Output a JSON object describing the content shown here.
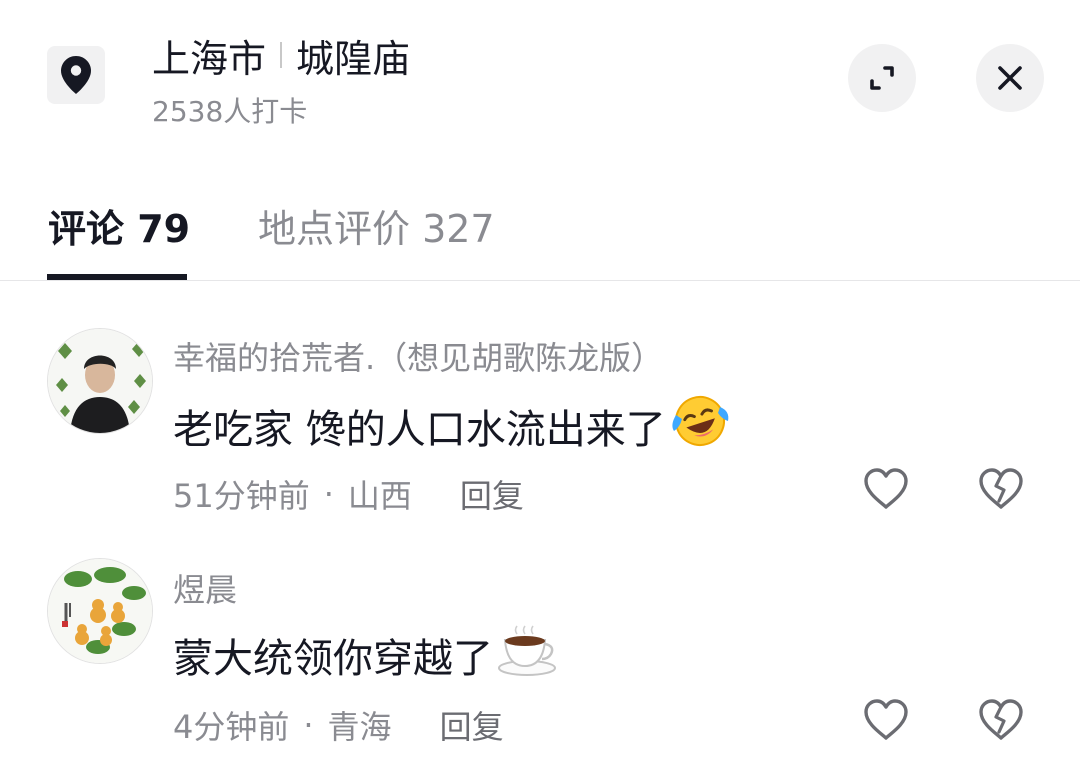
{
  "header": {
    "city": "上海市",
    "place": "城隍庙",
    "checkin": "2538人打卡",
    "location_icon": "location-pin-icon",
    "expand_icon": "expand-icon",
    "close_icon": "close-icon"
  },
  "tabs": [
    {
      "label": "评论 79",
      "active": true
    },
    {
      "label": "地点评价 327",
      "active": false
    }
  ],
  "comments": [
    {
      "username": "幸福的拾荒者.（想见胡歌陈龙版）",
      "text": "老吃家  馋的人口水流出来了",
      "emoji": "laughing-crying-emoji",
      "time": "51分钟前",
      "dot": "·",
      "region": "山西",
      "reply": "回复"
    },
    {
      "username": "煜晨",
      "text": "蒙大统领你穿越了",
      "emoji": "coffee-cup-emoji",
      "time": "4分钟前",
      "dot": "·",
      "region": "青海",
      "reply": "回复"
    }
  ],
  "colors": {
    "primary_text": "#161823",
    "secondary_text": "#8a8b91",
    "button_bg": "#f1f1f2"
  }
}
